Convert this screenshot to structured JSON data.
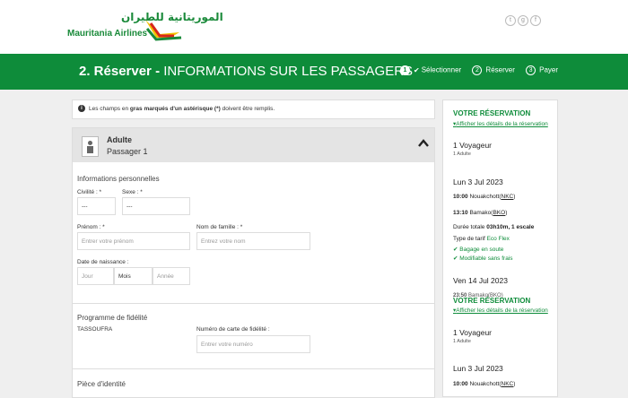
{
  "header": {
    "logo_arabic": "الموريتانية للطيران",
    "logo_english": "Mauritania Airlines",
    "social": [
      "twitter-icon",
      "google-plus-icon",
      "facebook-icon"
    ]
  },
  "progress": {
    "title_number": "2. Réserver -",
    "title_rest": "INFORMATIONS SUR LES PASSAGERS",
    "steps": [
      {
        "num": "1",
        "label": "Sélectionner",
        "done": true
      },
      {
        "num": "2",
        "label": "Réserver"
      },
      {
        "num": "3",
        "label": "Payer"
      }
    ]
  },
  "notice": {
    "before": "Les champs en",
    "bold": "gras marqués d'un astérisque (*)",
    "after": "doivent être remplis."
  },
  "passenger": {
    "type": "Adulte",
    "label": "Passager 1",
    "personal_title": "Informations personnelles",
    "civilite_label": "Civilité : *",
    "civilite_value": "---",
    "sexe_label": "Sexe : *",
    "sexe_value": "---",
    "prenom_label": "Prénom : *",
    "prenom_placeholder": "Entrer votre prénom",
    "nom_label": "Nom de famille : *",
    "nom_placeholder": "Entrez votre nom",
    "dob_label": "Date de naissance :",
    "dob_day": "Jour",
    "dob_month": "Mois",
    "dob_year": "Année",
    "loyalty_title": "Programme de fidélité",
    "loyalty_program": "TASSOUFRA",
    "card_label": "Numéro de carte de fidélité :",
    "card_placeholder": "Entrer votre numéro",
    "id_title": "Pièce d'identité"
  },
  "summary": {
    "title": "VOTRE RÉSERVATION",
    "details_link": "Afficher les détails de la réservation",
    "travellers": "1 Voyageur",
    "travellers_sub": "1 Adulte",
    "outbound": {
      "date": "Lun 3 Jul 2023",
      "dep_time": "10:00",
      "dep_city": "Nouakchott",
      "dep_code": "NKC",
      "arr_time": "13:10",
      "arr_city": "Bamako",
      "arr_code": "BKO",
      "duration_label": "Durée totale",
      "duration": "03h10m, 1 escale",
      "fare_label": "Type de tarif",
      "fare": "Eco Flex",
      "features": [
        "Bagage en soute",
        "Modifiable sans frais"
      ]
    },
    "return_date": "Ven 14 Jul 2023",
    "overlap_time": "23:50",
    "overlap_city": "Bamako",
    "overlap_code": "BKO",
    "title_repeat": "VOTRE RÉSERVATION",
    "details_link_repeat": "Afficher les détails de la réservation",
    "travellers_repeat": "1 Voyageur",
    "travellers_sub_repeat": "1 Adulte",
    "date_repeat": "Lun 3 Jul 2023",
    "dep_time_repeat": "10:00",
    "dep_city_repeat": "Nouakchott",
    "dep_code_repeat": "NKC"
  }
}
